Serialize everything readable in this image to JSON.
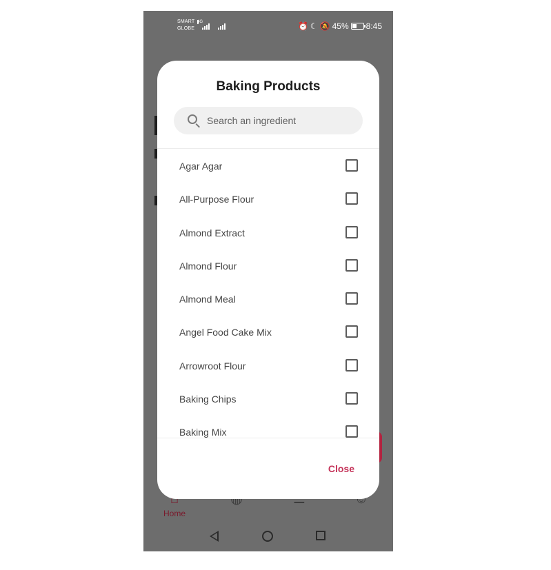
{
  "status_bar": {
    "carrier_line1": "SMART",
    "carrier_line2": "GLOBE",
    "network": "4G",
    "battery": "45%",
    "battery_level": 0.45,
    "time": "8:45"
  },
  "dialog": {
    "title": "Baking Products",
    "search_placeholder": "Search an ingredient",
    "items": [
      {
        "label": "Agar Agar",
        "checked": false
      },
      {
        "label": "All-Purpose Flour",
        "checked": false
      },
      {
        "label": "Almond Extract",
        "checked": false
      },
      {
        "label": "Almond Flour",
        "checked": false
      },
      {
        "label": "Almond Meal",
        "checked": false
      },
      {
        "label": "Angel Food Cake Mix",
        "checked": false
      },
      {
        "label": "Arrowroot Flour",
        "checked": false
      },
      {
        "label": "Baking Chips",
        "checked": false
      },
      {
        "label": "Baking Mix",
        "checked": false
      }
    ],
    "close_label": "Close"
  },
  "bottom_nav": {
    "home_label": "Home"
  },
  "colors": {
    "accent": "#c5345a",
    "scrim": "#6d6d6d",
    "nav_active": "#7a1a2c"
  },
  "icons": [
    "search-icon",
    "checkbox-icon",
    "home-icon",
    "globe-icon",
    "recipe-icon",
    "profile-icon",
    "back-icon",
    "home-circle-icon",
    "recents-icon"
  ]
}
